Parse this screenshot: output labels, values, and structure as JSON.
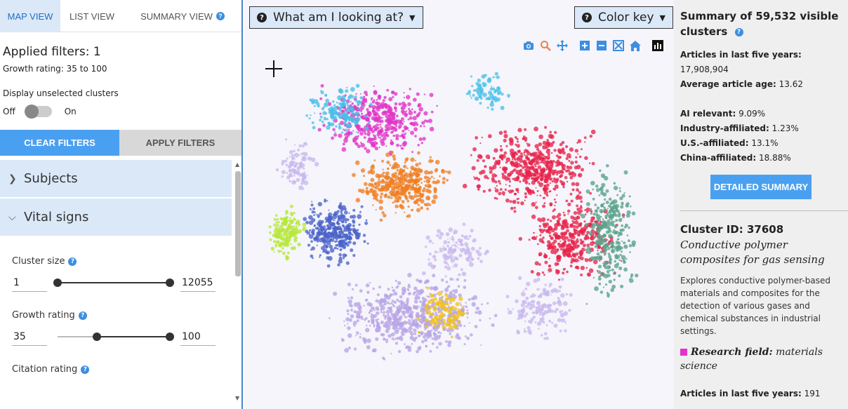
{
  "tabs": [
    {
      "label": "MAP VIEW",
      "active": true
    },
    {
      "label": "LIST VIEW",
      "active": false
    },
    {
      "label": "SUMMARY VIEW",
      "active": false
    }
  ],
  "filters": {
    "applied_label": "Applied filters: 1",
    "growth_text": "Growth rating: 35 to 100",
    "display_unselected": "Display unselected clusters",
    "toggle_off": "Off",
    "toggle_on": "On",
    "clear_button": "CLEAR FILTERS",
    "apply_button": "APPLY FILTERS"
  },
  "accordion": {
    "subjects": "Subjects",
    "vital_signs": "Vital signs"
  },
  "sliders": [
    {
      "label": "Cluster size",
      "min_value": "1",
      "max_value": "12055",
      "low": 0.0,
      "high": 1.0
    },
    {
      "label": "Growth rating",
      "min_value": "35",
      "max_value": "100",
      "low": 0.35,
      "high": 1.0
    },
    {
      "label": "Citation rating"
    }
  ],
  "map": {
    "help_button": "What am I looking at?",
    "color_key_button": "Color key",
    "modebar_icons": [
      "camera-icon",
      "zoom-icon",
      "pan-icon",
      "zoom-in-icon",
      "zoom-out-icon",
      "autoscale-icon",
      "home-icon",
      "plotly-logo-icon"
    ],
    "palette": [
      "#e8234a",
      "#f07f23",
      "#e234c8",
      "#b7a4e6",
      "#4a63c9",
      "#f2c31a",
      "#5aa38a",
      "#48c0e8",
      "#b6e83a",
      "#c9b8ee"
    ]
  },
  "summary": {
    "title": "Summary of 59,532 visible clusters",
    "articles_label": "Articles in last five years:",
    "articles_value": "17,908,904",
    "age_label": "Average article age:",
    "age_value": "13.62",
    "ai_label": "AI relevant:",
    "ai_value": "9.09%",
    "industry_label": "Industry-affiliated:",
    "industry_value": "1.23%",
    "us_label": "U.S.-affiliated:",
    "us_value": "13.1%",
    "china_label": "China-affiliated:",
    "china_value": "18.88%",
    "detailed_button": "DETAILED SUMMARY"
  },
  "cluster": {
    "id_label": "Cluster ID: 37608",
    "title": "Conductive polymer composites for gas sensing",
    "description": "Explores conductive polymer-based materials and composites for the detection of various gases and chemical substances in industrial settings.",
    "field_label": "Research field:",
    "field_value": "materials science",
    "field_color": "#e234c8",
    "articles_label": "Articles in last five years:",
    "articles_value": "191"
  }
}
